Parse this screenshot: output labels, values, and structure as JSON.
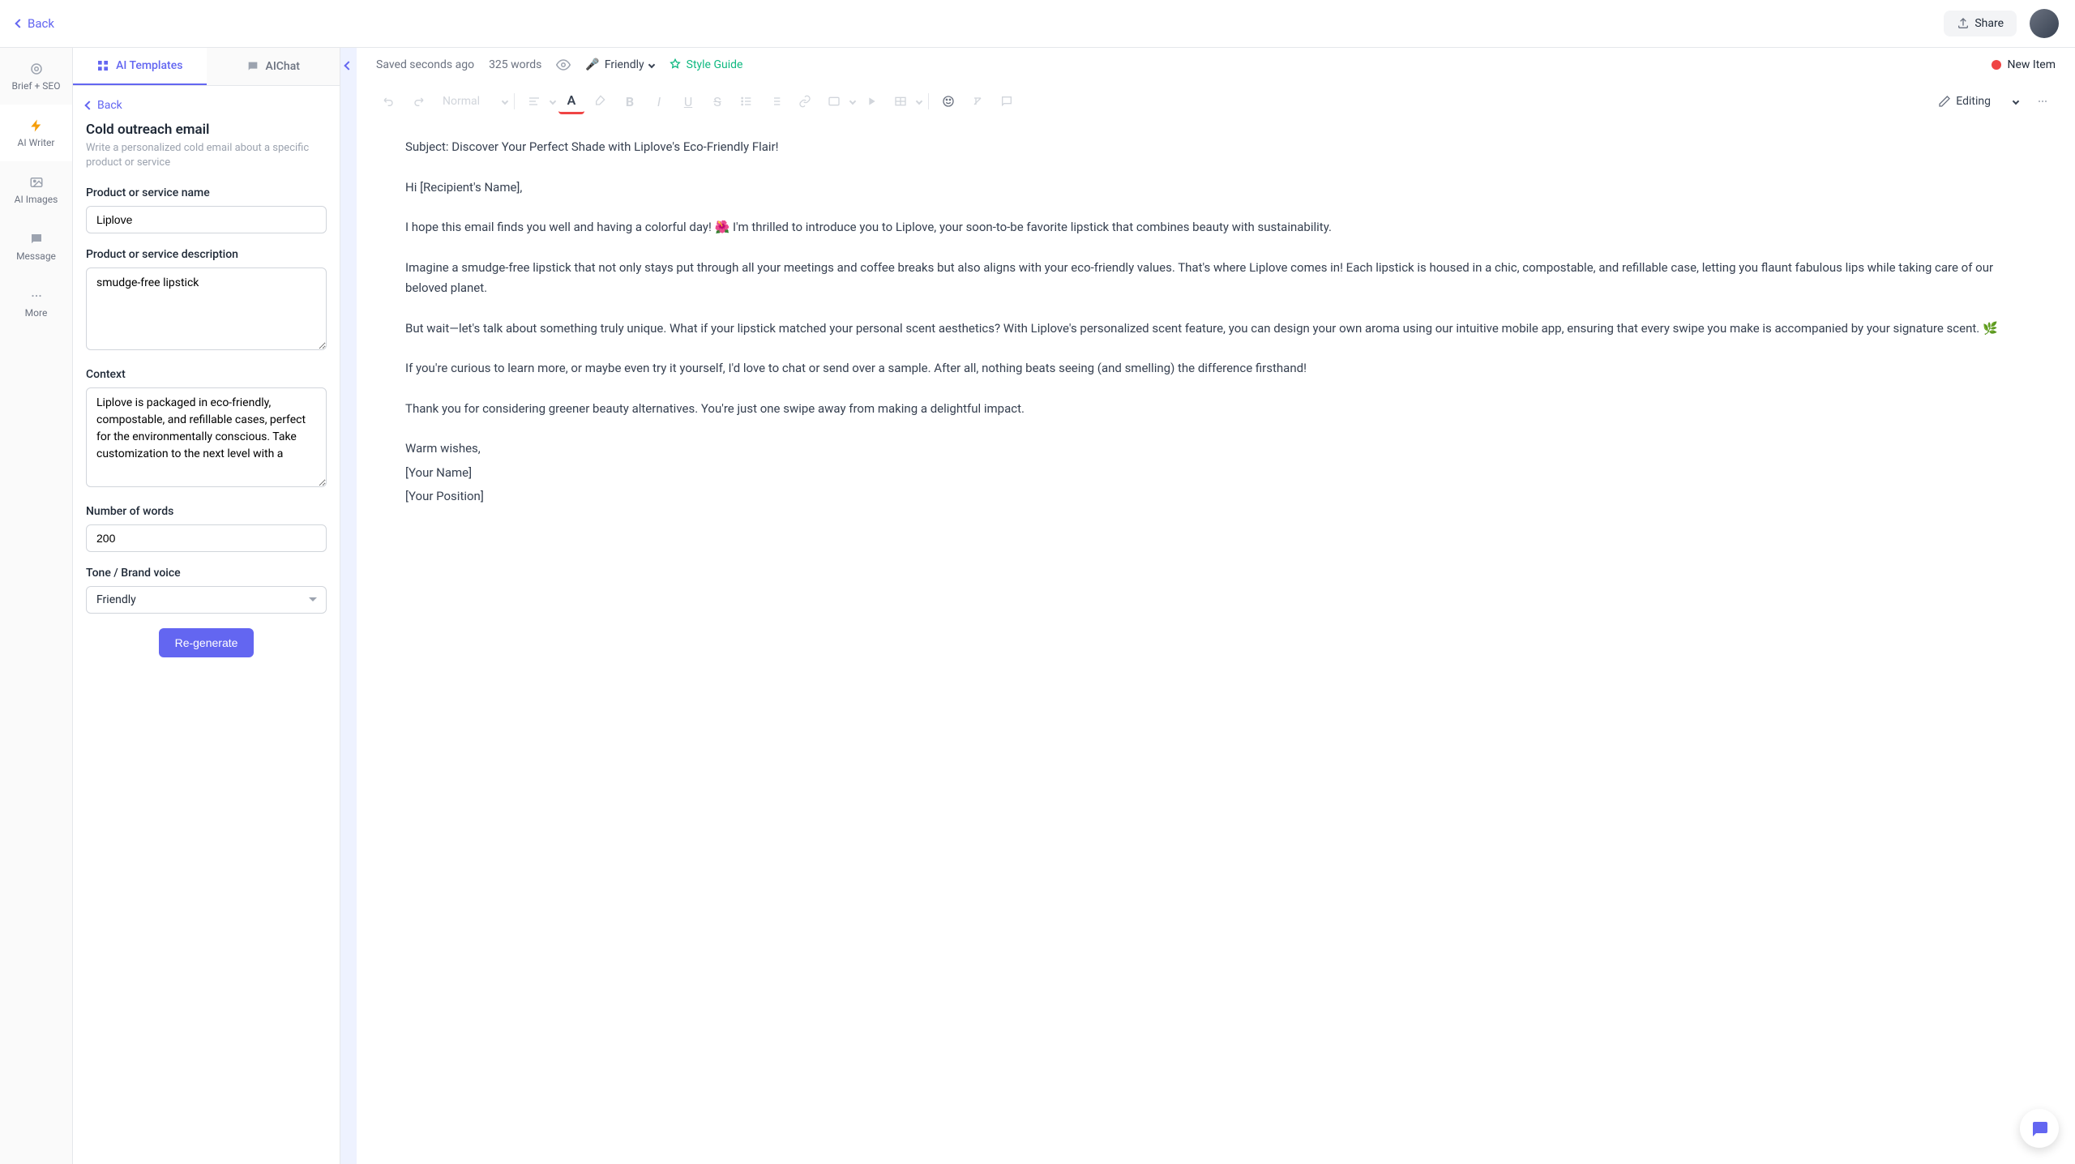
{
  "top": {
    "back": "Back",
    "share": "Share"
  },
  "rail": {
    "items": [
      {
        "label": "Brief + SEO"
      },
      {
        "label": "AI Writer"
      },
      {
        "label": "AI Images"
      },
      {
        "label": "Message"
      },
      {
        "label": "More"
      }
    ]
  },
  "tabs": {
    "templates": "AI Templates",
    "chat": "AIChat"
  },
  "sidebar": {
    "back": "Back",
    "title": "Cold outreach email",
    "desc": "Write a personalized cold email about a specific product or service",
    "labels": {
      "name": "Product or service name",
      "description": "Product or service description",
      "context": "Context",
      "words": "Number of words",
      "tone": "Tone / Brand voice"
    },
    "values": {
      "name": "Liplove",
      "description": "smudge-free lipstick",
      "context": "Liplove is packaged in eco-friendly, compostable, and refillable cases, perfect for the environmentally conscious. Take customization to the next level with a",
      "words": "200",
      "tone": "Friendly"
    },
    "regenerate": "Re-generate"
  },
  "editor": {
    "saved": "Saved seconds ago",
    "wordcount": "325 words",
    "tone": "Friendly",
    "styleguide": "Style Guide",
    "newitem": "New Item",
    "format": "Normal",
    "editing": "Editing",
    "content": {
      "subject": "Subject: Discover Your Perfect Shade with Liplove's Eco-Friendly Flair!",
      "greeting": "Hi [Recipient's Name],",
      "p1": "I hope this email finds you well and having a colorful day! 🌺 I'm thrilled to introduce you to Liplove, your soon-to-be favorite lipstick that combines beauty with sustainability.",
      "p2": "Imagine a smudge-free lipstick that not only stays put through all your meetings and coffee breaks but also aligns with your eco-friendly values. That's where Liplove comes in! Each lipstick is housed in a chic, compostable, and refillable case, letting you flaunt fabulous lips while taking care of our beloved planet.",
      "p3": "But wait—let's talk about something truly unique. What if your lipstick matched your personal scent aesthetics? With Liplove's personalized scent feature, you can design your own aroma using our intuitive mobile app, ensuring that every swipe you make is accompanied by your signature scent. 🌿",
      "p4": "If you're curious to learn more, or maybe even try it yourself, I'd love to chat or send over a sample. After all, nothing beats seeing (and smelling) the difference firsthand!",
      "p5": "Thank you for considering greener beauty alternatives. You're just one swipe away from making a delightful impact.",
      "closing": "Warm wishes,",
      "sig1": "[Your Name]",
      "sig2": "[Your Position]"
    }
  }
}
